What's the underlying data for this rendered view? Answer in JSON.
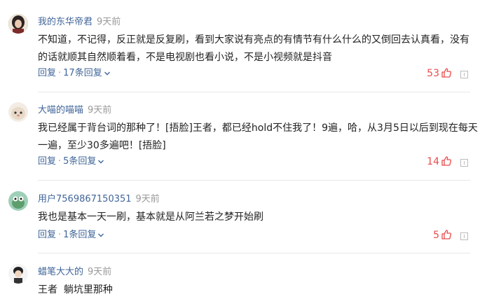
{
  "comments": [
    {
      "username": "我的东华帝君",
      "time": "9天前",
      "text": "不知道，不记得，反正就是反复刷，看到大家说有亮点的有情节有什么什么的又倒回去认真看，没有的话就顺其自然顺着看，不是电视剧也看小说，不是小视频就是抖音",
      "reply_label": "回复",
      "separator": "·",
      "replies": "17条回复",
      "likes": "53"
    },
    {
      "username": "大喵的喵喵",
      "time": "9天前",
      "text": "我已经属于背台词的那种了！[捂脸]王者，都已经hold不住我了！9遍，哈，从3月5日以后到现在每天一遍，至少30多遍吧！[捂脸]",
      "reply_label": "回复",
      "separator": "·",
      "replies": "5条回复",
      "likes": "14"
    },
    {
      "username": "用户7569867150351",
      "time": "9天前",
      "text": "我也是基本一天一刷，基本就是从阿兰若之梦开始刷",
      "reply_label": "回复",
      "separator": "·",
      "replies": "1条回复",
      "likes": "5"
    },
    {
      "username": "蜡笔大大的",
      "time": "9天前",
      "text": "王者  躺坑里那种"
    }
  ],
  "colors": {
    "username": "#406599",
    "meta": "#999999",
    "like": "#ea4b4b"
  },
  "icons": {
    "like": "thumbs-up-icon",
    "report": "report-icon",
    "expand": "chevron-down-icon"
  }
}
